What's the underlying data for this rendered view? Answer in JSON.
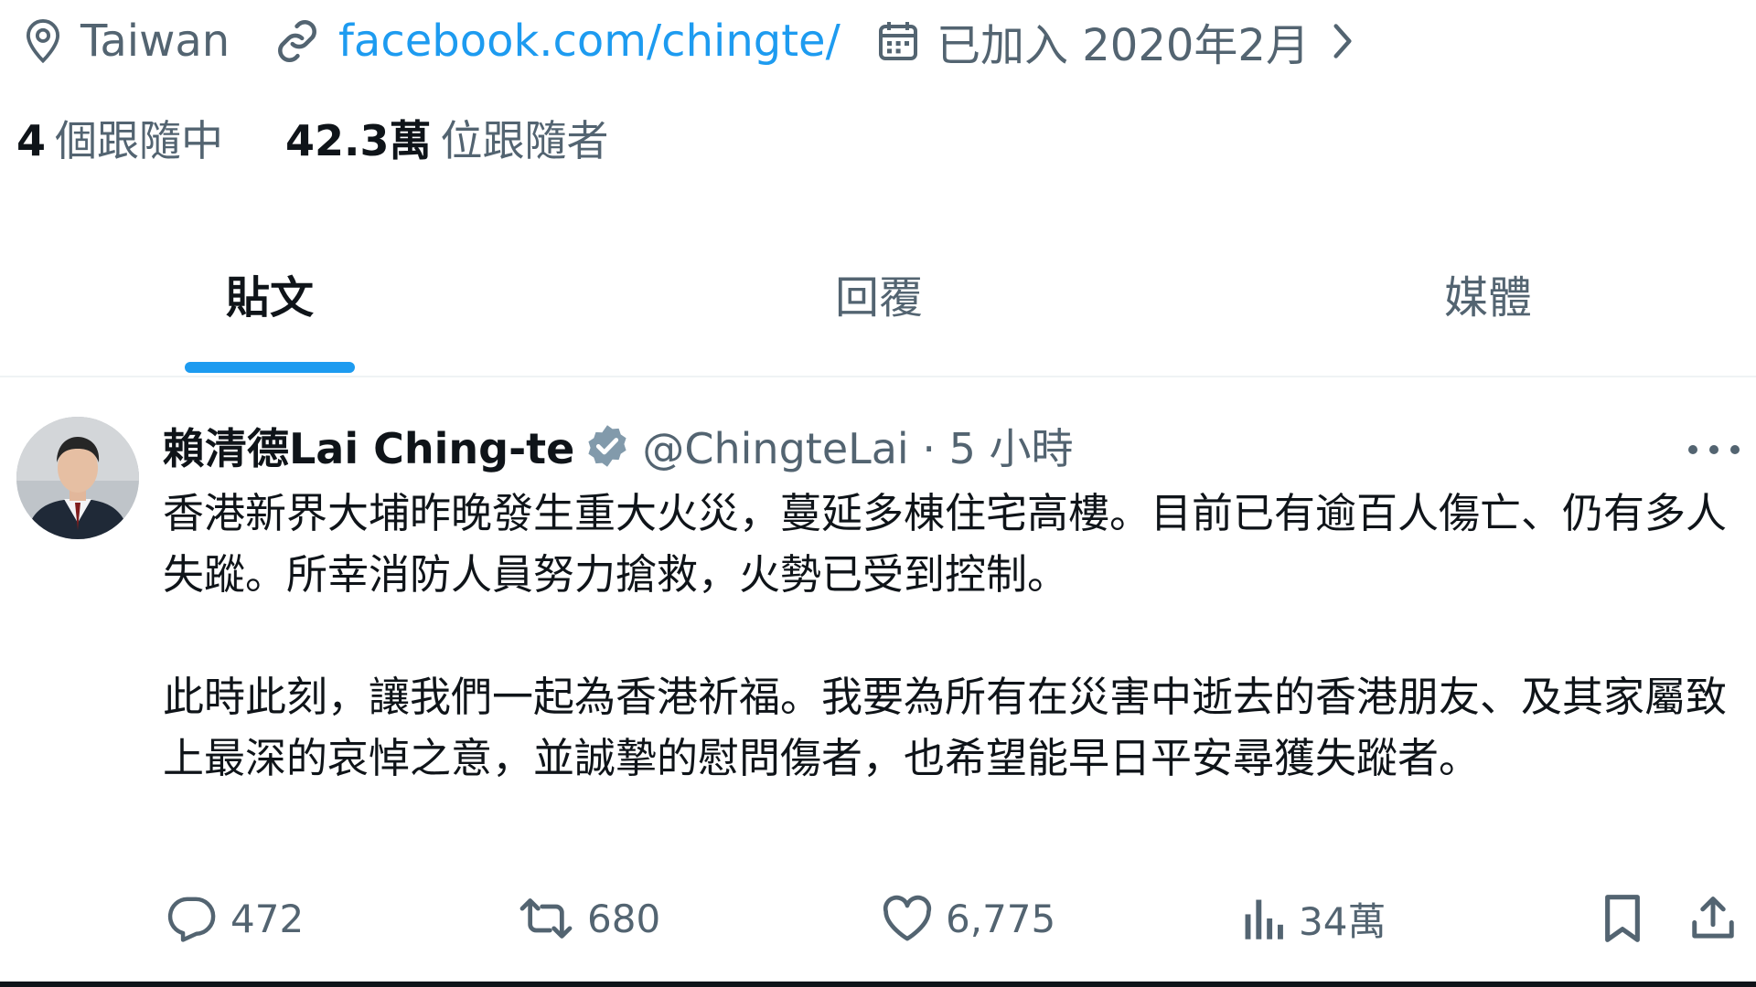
{
  "profile": {
    "location": "Taiwan",
    "website": "facebook.com/chingte/",
    "joined": "已加入 2020年2月",
    "following_count": "4",
    "following_label": "個跟隨中",
    "followers_count": "42.3萬",
    "followers_label": "位跟隨者"
  },
  "tabs": [
    {
      "label": "貼文",
      "active": true
    },
    {
      "label": "回覆",
      "active": false
    },
    {
      "label": "媒體",
      "active": false
    }
  ],
  "tweet": {
    "author_name": "賴清德Lai Ching-te",
    "handle_time": "@ChingteLai · 5 小時",
    "paragraphs": [
      "香港新界大埔昨晚發生重大火災，蔓延多棟住宅高樓。目前已有逾百人傷亡、仍有多人失蹤。所幸消防人員努力搶救，火勢已受到控制。",
      "此時此刻，讓我們一起為香港祈福。我要為所有在災害中逝去的香港朋友、及其家屬致上最深的哀悼之意，並誠摯的慰問傷者，也希望能早日平安尋獲失蹤者。"
    ],
    "replies": "472",
    "reposts": "680",
    "likes": "6,775",
    "views": "34萬"
  },
  "icons": [
    "location-icon",
    "link-icon",
    "calendar-icon",
    "chevron-right-icon",
    "verified-badge-icon",
    "more-icon",
    "reply-icon",
    "repost-icon",
    "like-icon",
    "views-icon",
    "bookmark-icon",
    "share-icon"
  ],
  "colors": {
    "accent": "#1d9bf0",
    "muted": "#536471",
    "text": "#0f1419",
    "verified": "#829aab"
  }
}
